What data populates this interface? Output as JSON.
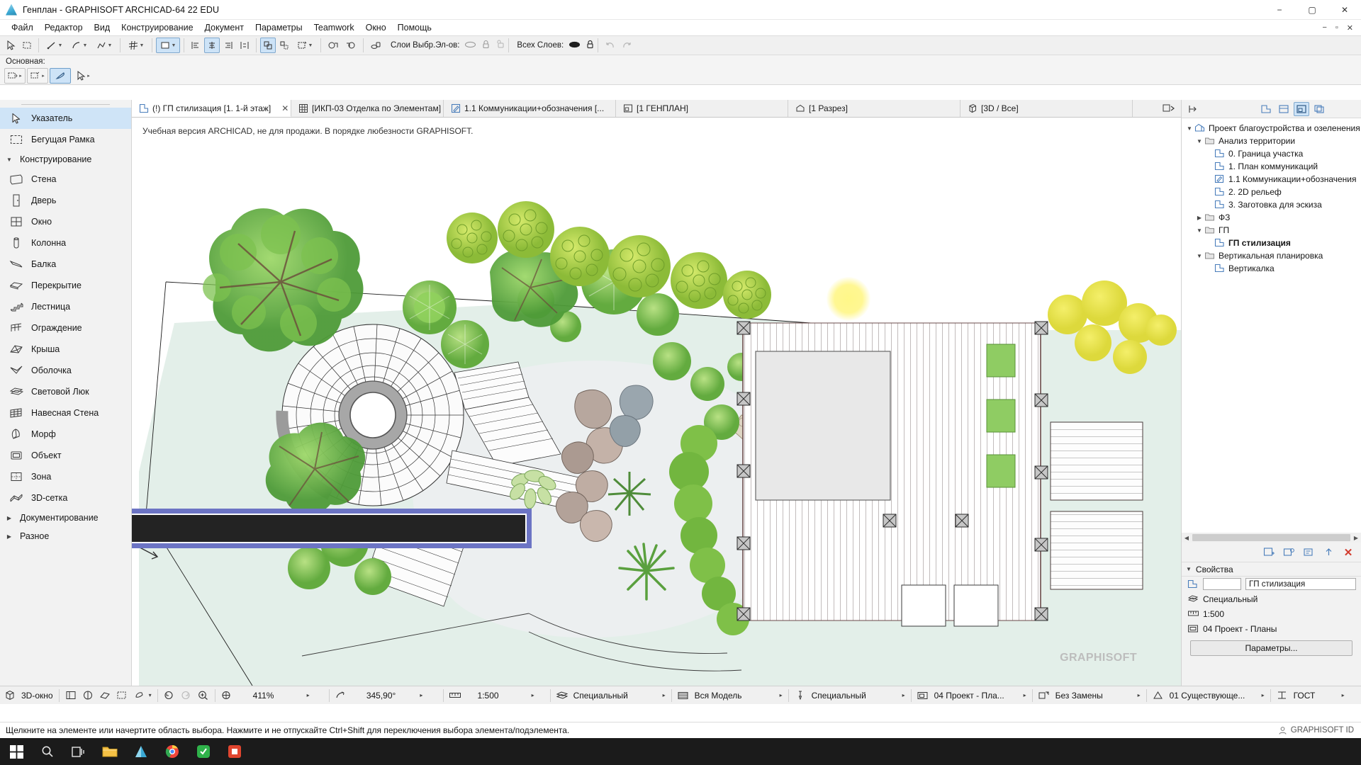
{
  "window": {
    "title": "Генплан - GRAPHISOFT ARCHICAD-64 22 EDU",
    "app_icon": "archicad-logo-icon",
    "minimize": "−",
    "maximize": "▢",
    "close": "✕",
    "mdi_minimize": "−",
    "mdi_restore": "▫",
    "mdi_close": "✕"
  },
  "menubar": {
    "items": [
      {
        "label": "Файл"
      },
      {
        "label": "Редактор"
      },
      {
        "label": "Вид"
      },
      {
        "label": "Конструирование"
      },
      {
        "label": "Документ"
      },
      {
        "label": "Параметры"
      },
      {
        "label": "Teamwork"
      },
      {
        "label": "Окно"
      },
      {
        "label": "Помощь"
      }
    ]
  },
  "toolbar": {
    "layers_selected_label": "Слои Выбр.Эл-ов:",
    "layers_all_label": "Всех Слоев:",
    "main_palette_label": "Основная:"
  },
  "toolbox": {
    "top": [
      {
        "label": "Указатель",
        "icon": "arrow-pointer-icon",
        "selected": true
      },
      {
        "label": "Бегущая Рамка",
        "icon": "marquee-icon",
        "selected": false
      }
    ],
    "groups": [
      {
        "label": "Конструирование",
        "expanded": true,
        "items": [
          {
            "label": "Стена",
            "icon": "wall-icon"
          },
          {
            "label": "Дверь",
            "icon": "door-icon"
          },
          {
            "label": "Окно",
            "icon": "window-icon"
          },
          {
            "label": "Колонна",
            "icon": "column-icon"
          },
          {
            "label": "Балка",
            "icon": "beam-icon"
          },
          {
            "label": "Перекрытие",
            "icon": "slab-icon"
          },
          {
            "label": "Лестница",
            "icon": "stair-icon"
          },
          {
            "label": "Ограждение",
            "icon": "railing-icon"
          },
          {
            "label": "Крыша",
            "icon": "roof-icon"
          },
          {
            "label": "Оболочка",
            "icon": "shell-icon"
          },
          {
            "label": "Световой Люк",
            "icon": "skylight-icon"
          },
          {
            "label": "Навесная Стена",
            "icon": "curtain-wall-icon"
          },
          {
            "label": "Морф",
            "icon": "morph-icon"
          },
          {
            "label": "Объект",
            "icon": "object-icon"
          },
          {
            "label": "Зона",
            "icon": "zone-icon"
          },
          {
            "label": "3D-сетка",
            "icon": "mesh-icon"
          }
        ]
      },
      {
        "label": "Документирование",
        "expanded": false,
        "items": []
      },
      {
        "label": "Разное",
        "expanded": false,
        "items": []
      }
    ]
  },
  "tabs": [
    {
      "label": "(!) ГП стилизация [1. 1-й этаж]",
      "icon": "floor-plan-icon",
      "active": true,
      "closable": true
    },
    {
      "label": "[ИКП-03 Отделка по Элементам]",
      "icon": "schedule-grid-icon",
      "active": false,
      "closable": false
    },
    {
      "label": "1.1 Коммуникации+обозначения [...",
      "icon": "worksheet-pencil-icon",
      "active": false,
      "closable": false
    },
    {
      "label": "[1 ГЕНПЛАН]",
      "icon": "layout-icon",
      "active": false,
      "closable": false
    },
    {
      "label": "[1 Разрез]",
      "icon": "section-icon",
      "active": false,
      "closable": false
    },
    {
      "label": "[3D / Все]",
      "icon": "3d-cube-icon",
      "active": false,
      "closable": false
    }
  ],
  "canvas": {
    "edu_notice": "Учебная версия ARCHICAD, не для продажи. В порядке любезности GRAPHISOFT.",
    "watermark": "GRAPHISOFT",
    "selection_color": "#6c74c4",
    "background": "#ffffff",
    "lawn_color": "#e3efe9",
    "paving_color": "#e8e8e8"
  },
  "navigator": {
    "toolbar_icons": [
      {
        "name": "project-map-icon",
        "active": false
      },
      {
        "name": "view-map-icon",
        "active": false
      },
      {
        "name": "layout-book-icon",
        "active": true
      },
      {
        "name": "publisher-sets-icon",
        "active": false
      }
    ],
    "tree": [
      {
        "label": "Проект благоустройства и озеленения",
        "level": 0,
        "twist": "v",
        "icon": "project-home-icon",
        "bold": false
      },
      {
        "label": "Анализ территории",
        "level": 1,
        "twist": "v",
        "icon": "folder-icon",
        "bold": false
      },
      {
        "label": "0. Граница участка",
        "level": 2,
        "twist": "",
        "icon": "floor-plan-icon",
        "bold": false
      },
      {
        "label": "1. План коммуникаций",
        "level": 2,
        "twist": "",
        "icon": "floor-plan-icon",
        "bold": false
      },
      {
        "label": "1.1 Коммуникации+обозначения",
        "level": 2,
        "twist": "",
        "icon": "worksheet-pencil-icon",
        "bold": false
      },
      {
        "label": "2. 2D рельеф",
        "level": 2,
        "twist": "",
        "icon": "floor-plan-icon",
        "bold": false
      },
      {
        "label": "3. Заготовка для эскиза",
        "level": 2,
        "twist": "",
        "icon": "floor-plan-icon",
        "bold": false
      },
      {
        "label": "ФЗ",
        "level": 1,
        "twist": ">",
        "icon": "folder-icon",
        "bold": false
      },
      {
        "label": "ГП",
        "level": 1,
        "twist": "v",
        "icon": "folder-icon",
        "bold": false
      },
      {
        "label": "ГП стилизация",
        "level": 2,
        "twist": "",
        "icon": "floor-plan-icon",
        "bold": true
      },
      {
        "label": "Вертикальная планировка",
        "level": 1,
        "twist": "v",
        "icon": "folder-icon",
        "bold": false
      },
      {
        "label": "Вертикалка",
        "level": 2,
        "twist": "",
        "icon": "floor-plan-icon",
        "bold": false
      }
    ],
    "bottom_buttons": [
      {
        "name": "new-view-icon"
      },
      {
        "name": "clone-folder-icon"
      },
      {
        "name": "settings-icon"
      },
      {
        "name": "move-up-icon"
      },
      {
        "name": "delete-icon"
      }
    ],
    "properties": {
      "title": "Свойства",
      "id_value": "",
      "name_value": "ГП стилизация",
      "layer_combination": "Специальный",
      "scale": "1:500",
      "pen_set": "04 Проект - Планы",
      "settings_button": "Параметры..."
    }
  },
  "status_toolbar": {
    "zoom": "411%",
    "rotation": "345,90°",
    "scale": "1:500",
    "layer_combination": "Специальный",
    "structure_display": "Вся Модель",
    "pen_set_short": "Специальный",
    "model_view": "04 Проект - Пла...",
    "renovation_filter": "Без Замены",
    "renovation_status": "01 Существующе...",
    "dimension_standard": "ГОСТ",
    "icons": [
      {
        "name": "zoom-previous-icon"
      },
      {
        "name": "zoom-next-icon"
      },
      {
        "name": "zoom-in-icon"
      },
      {
        "name": "fit-in-window-icon"
      },
      {
        "name": "orientation-icon"
      },
      {
        "name": "scale-icon"
      },
      {
        "name": "layer-combination-icon"
      },
      {
        "name": "partial-structure-icon"
      },
      {
        "name": "pen-set-icon"
      },
      {
        "name": "model-view-icon"
      },
      {
        "name": "renovation-filter-icon"
      },
      {
        "name": "renovation-status-icon"
      },
      {
        "name": "dimension-icon"
      }
    ],
    "left_button": "3D-окно"
  },
  "statusbar": {
    "message": "Щелкните на элементе или начертите область выбора. Нажмите и не отпускайте Ctrl+Shift для переключения выбора элемента/подэлемента.",
    "gsid": "GRAPHISOFT ID"
  },
  "taskbar": {
    "items": [
      {
        "name": "start-button-icon"
      },
      {
        "name": "search-icon"
      },
      {
        "name": "task-view-icon"
      },
      {
        "name": "file-explorer-icon"
      },
      {
        "name": "archicad-taskbar-icon"
      },
      {
        "name": "chrome-icon"
      },
      {
        "name": "messenger-icon"
      },
      {
        "name": "app-red-icon"
      }
    ]
  }
}
